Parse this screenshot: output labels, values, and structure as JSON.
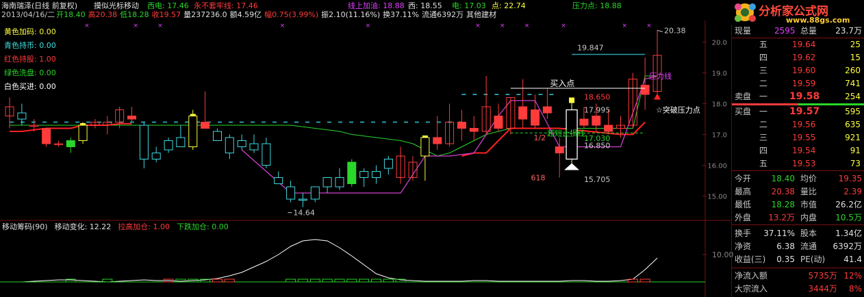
{
  "header": {
    "line1": [
      {
        "text": "海南瑞泽(日线 前复权)",
        "color": "#e0e0e0"
      },
      {
        "text": "摸似光标移动",
        "color": "#e0e0e0"
      },
      {
        "text": "西电: 17.46",
        "color": "#2ad62a"
      },
      {
        "text": "永不套牢线: 17.46",
        "color": "#ff3b3b"
      },
      {
        "text": "线上加油: 18.88",
        "color": "#e040fb"
      },
      {
        "text": "西: 18.55",
        "color": "#e0e0e0"
      },
      {
        "text": "电: 17.03",
        "color": "#2ad62a"
      },
      {
        "text": "点: 22.74",
        "color": "#ffff40"
      },
      {
        "text": "压力点: 18.88",
        "color": "#2ad62a"
      }
    ],
    "line2": [
      {
        "text": "2013/04/16/二",
        "color": "#c8c8c8"
      },
      {
        "text": "开18.40",
        "color": "#2ad62a"
      },
      {
        "text": "高20.38",
        "color": "#ff3b3b"
      },
      {
        "text": "低18.28",
        "color": "#2ad62a"
      },
      {
        "text": "收19.57",
        "color": "#ff3b3b"
      },
      {
        "text": "量237236.0",
        "color": "#e0e0e0"
      },
      {
        "text": "额4.59亿",
        "color": "#e0e0e0"
      },
      {
        "text": "幅0.75(3.99%)",
        "color": "#ff3b3b"
      },
      {
        "text": "振2.10(11.16%)",
        "color": "#e0e0e0"
      },
      {
        "text": "换37.11%",
        "color": "#e0e0e0"
      },
      {
        "text": "流通6392万",
        "color": "#e0e0e0"
      },
      {
        "text": "其他建材",
        "color": "#e0e0e0"
      }
    ]
  },
  "legend": [
    {
      "label": "黄色加码: 0.00",
      "color": "#ffff40"
    },
    {
      "label": "青色持币: 0.00",
      "color": "#40e0e0"
    },
    {
      "label": "红色持股: 1.00",
      "color": "#ff3b3b"
    },
    {
      "label": "绿色洗盘: 0.00",
      "color": "#2ad62a"
    },
    {
      "label": "白色买进: 0.00",
      "color": "#ffffff"
    }
  ],
  "indicator": {
    "items": [
      {
        "text": "移动筹码(90)",
        "color": "#e0e0e0"
      },
      {
        "text": "移动变化: 12.22",
        "color": "#e0e0e0"
      },
      {
        "text": "拉高加仓: 1.00",
        "color": "#ff3b3b"
      },
      {
        "text": "下跌加仓: 0.00",
        "color": "#2ad62a"
      }
    ],
    "axis_label": "10.00"
  },
  "brand": {
    "title": "分析家公式网",
    "url": "www.88gs.com"
  },
  "annotations": {
    "buy_point": "买入点",
    "pressure_line": "压力线",
    "breakout": "☆突破压力点",
    "cut_loss": "超短止损线",
    "half": "1/2",
    "low_mark": "618",
    "low_price": "14.64",
    "high_price": "20.38",
    "levels": [
      "19.847",
      "18.650",
      "17.995",
      "17.030",
      "16.850",
      "15.705"
    ]
  },
  "price_axis": [
    "20.0",
    "19.0",
    "18.0",
    "17.0",
    "16.00",
    "15.00"
  ],
  "quote": {
    "xianliang": {
      "label": "现量",
      "value": "2595"
    },
    "zongliang": {
      "label": "总量",
      "value": "23.7万"
    },
    "asks": [
      {
        "label": "五",
        "price": "19.64",
        "vol": "25"
      },
      {
        "label": "四",
        "price": "19.62",
        "vol": "15"
      },
      {
        "label": "三",
        "price": "19.60",
        "vol": "260"
      },
      {
        "label": "二",
        "price": "19.59",
        "vol": "741"
      },
      {
        "label": "一",
        "price": "19.58",
        "vol": "254"
      }
    ],
    "ask_title": "卖盘",
    "bid_title": "买盘",
    "bids": [
      {
        "label": "一",
        "price": "19.57",
        "vol": "595"
      },
      {
        "label": "二",
        "price": "19.56",
        "vol": "635"
      },
      {
        "label": "三",
        "price": "19.55",
        "vol": "921"
      },
      {
        "label": "四",
        "price": "19.54",
        "vol": "91"
      },
      {
        "label": "五",
        "price": "19.53",
        "vol": "73"
      }
    ],
    "stats": [
      {
        "l1": "今开",
        "v1": "18.40",
        "c1": "#2ad62a",
        "l2": "均价",
        "v2": "19.35",
        "c2": "#ff3b3b"
      },
      {
        "l1": "最高",
        "v1": "20.38",
        "c1": "#ff3b3b",
        "l2": "量比",
        "v2": "2.39",
        "c2": "#ff3b3b"
      },
      {
        "l1": "最低",
        "v1": "18.28",
        "c1": "#2ad62a",
        "l2": "市值",
        "v2": "26.2亿",
        "c2": "#e0e0e0"
      },
      {
        "l1": "外盘",
        "v1": "13.2万",
        "c1": "#ff3b3b",
        "l2": "内盘",
        "v2": "10.5万",
        "c2": "#2ad62a"
      }
    ],
    "stats2": [
      {
        "l1": "换手",
        "v1": "37.11%",
        "l2": "股本",
        "v2": "1.34亿"
      },
      {
        "l1": "净资",
        "v1": "6.38",
        "l2": "流通",
        "v2": "6392万"
      },
      {
        "l1": "收益(三)",
        "v1": "0.35",
        "l2": "PE(动)",
        "v2": "41.4"
      }
    ],
    "flows": [
      {
        "label": "净流入额",
        "value": "5735万",
        "pct": "12%"
      },
      {
        "label": "大宗流入",
        "value": "3444万",
        "pct": "8%"
      }
    ]
  },
  "chart_data": {
    "type": "candlestick",
    "y_axis_ticks": [
      20,
      19,
      18,
      17,
      16,
      15
    ],
    "ylim": [
      14.3,
      20.7
    ],
    "candles": [
      {
        "o": 17.6,
        "h": 18.2,
        "l": 17.2,
        "c": 17.9
      },
      {
        "o": 17.7,
        "h": 18.0,
        "l": 17.3,
        "c": 17.5
      },
      {
        "o": 17.3,
        "h": 17.5,
        "l": 17.1,
        "c": 17.3
      },
      {
        "o": 17.2,
        "h": 17.2,
        "l": 16.6,
        "c": 16.7
      },
      {
        "o": 16.7,
        "h": 16.8,
        "l": 16.6,
        "c": 16.7
      },
      {
        "o": 16.6,
        "h": 16.9,
        "l": 16.4,
        "c": 16.8
      },
      {
        "o": 16.8,
        "h": 17.4,
        "l": 16.7,
        "c": 17.3
      },
      {
        "o": 17.3,
        "h": 17.5,
        "l": 17.2,
        "c": 17.4
      },
      {
        "o": 17.3,
        "h": 17.6,
        "l": 17.0,
        "c": 17.4
      },
      {
        "o": 17.4,
        "h": 17.9,
        "l": 17.2,
        "c": 17.8
      },
      {
        "o": 17.6,
        "h": 17.9,
        "l": 17.4,
        "c": 17.5
      },
      {
        "o": 17.3,
        "h": 17.4,
        "l": 15.9,
        "c": 16.2
      },
      {
        "o": 16.4,
        "h": 16.6,
        "l": 16.1,
        "c": 16.2
      },
      {
        "o": 16.5,
        "h": 16.9,
        "l": 16.4,
        "c": 16.8
      },
      {
        "o": 16.9,
        "h": 17.3,
        "l": 16.6,
        "c": 16.6
      },
      {
        "o": 16.6,
        "h": 17.8,
        "l": 16.5,
        "c": 17.6
      },
      {
        "o": 17.4,
        "h": 18.4,
        "l": 17.3,
        "c": 17.2
      },
      {
        "o": 17.1,
        "h": 17.2,
        "l": 16.8,
        "c": 16.8
      },
      {
        "o": 16.9,
        "h": 17.0,
        "l": 16.2,
        "c": 16.4
      },
      {
        "o": 16.8,
        "h": 17.0,
        "l": 16.5,
        "c": 16.6
      },
      {
        "o": 16.7,
        "h": 17.0,
        "l": 16.4,
        "c": 16.5
      },
      {
        "o": 16.7,
        "h": 16.9,
        "l": 15.9,
        "c": 16.0
      },
      {
        "o": 15.6,
        "h": 15.8,
        "l": 15.4,
        "c": 15.4
      },
      {
        "o": 15.3,
        "h": 15.5,
        "l": 14.8,
        "c": 14.9
      },
      {
        "o": 14.9,
        "h": 15.1,
        "l": 14.64,
        "c": 14.9
      },
      {
        "o": 14.9,
        "h": 15.3,
        "l": 14.8,
        "c": 15.3
      },
      {
        "o": 15.3,
        "h": 15.6,
        "l": 15.1,
        "c": 15.6
      },
      {
        "o": 15.6,
        "h": 15.9,
        "l": 15.2,
        "c": 15.3
      },
      {
        "o": 15.4,
        "h": 16.2,
        "l": 15.3,
        "c": 16.1
      },
      {
        "o": 15.6,
        "h": 15.9,
        "l": 15.3,
        "c": 15.8
      },
      {
        "o": 15.8,
        "h": 16.0,
        "l": 15.4,
        "c": 15.6
      },
      {
        "o": 15.9,
        "h": 16.3,
        "l": 15.7,
        "c": 16.2
      },
      {
        "o": 15.6,
        "h": 16.6,
        "l": 15.4,
        "c": 16.3
      },
      {
        "o": 15.6,
        "h": 16.3,
        "l": 15.5,
        "c": 16.1
      },
      {
        "o": 16.3,
        "h": 16.9,
        "l": 15.5,
        "c": 16.9
      },
      {
        "o": 16.9,
        "h": 17.6,
        "l": 16.5,
        "c": 16.7
      },
      {
        "o": 16.7,
        "h": 18.0,
        "l": 16.6,
        "c": 17.4
      },
      {
        "o": 17.4,
        "h": 17.8,
        "l": 16.8,
        "c": 17.2
      },
      {
        "o": 17.2,
        "h": 17.6,
        "l": 16.8,
        "c": 17.1
      },
      {
        "o": 17.1,
        "h": 18.9,
        "l": 17.0,
        "c": 17.9
      },
      {
        "o": 17.6,
        "h": 18.0,
        "l": 17.1,
        "c": 17.2
      },
      {
        "o": 17.2,
        "h": 18.2,
        "l": 17.0,
        "c": 18.2
      },
      {
        "o": 17.9,
        "h": 18.8,
        "l": 17.2,
        "c": 17.5
      },
      {
        "o": 17.8,
        "h": 18.3,
        "l": 17.2,
        "c": 17.3
      },
      {
        "o": 17.9,
        "h": 18.5,
        "l": 17.5,
        "c": 17.7
      },
      {
        "o": 16.6,
        "h": 16.9,
        "l": 15.6,
        "c": 16.4
      },
      {
        "o": 16.2,
        "h": 18.2,
        "l": 16.0,
        "c": 17.6
      },
      {
        "o": 17.5,
        "h": 17.9,
        "l": 17.2,
        "c": 17.3
      },
      {
        "o": 17.6,
        "h": 18.0,
        "l": 17.1,
        "c": 17.3
      },
      {
        "o": 17.3,
        "h": 17.8,
        "l": 17.0,
        "c": 17.1
      },
      {
        "o": 17.2,
        "h": 17.6,
        "l": 16.9,
        "c": 17.3
      },
      {
        "o": 17.3,
        "h": 19.0,
        "l": 17.2,
        "c": 18.8
      },
      {
        "o": 18.6,
        "h": 19.5,
        "l": 17.8,
        "c": 18.3
      },
      {
        "o": 18.4,
        "h": 20.38,
        "l": 18.28,
        "c": 19.57
      }
    ],
    "upper_colors": [
      "red",
      "cyan",
      "red",
      "red",
      "red",
      "green",
      "yellow",
      "red",
      "red",
      "red",
      "red",
      "cyan",
      "cyan",
      "cyan",
      "cyan",
      "yellow",
      "red",
      "cyan",
      "cyan",
      "cyan",
      "cyan",
      "cyan",
      "cyan",
      "cyan",
      "cyan",
      "cyan",
      "cyan",
      "cyan",
      "green",
      "cyan",
      "cyan",
      "cyan",
      "red",
      "red",
      "yellow",
      "red",
      "red",
      "red",
      "red",
      "red",
      "red",
      "red",
      "red",
      "red",
      "red",
      "red",
      "yellow",
      "red",
      "red",
      "red",
      "red",
      "red",
      "red",
      "red"
    ]
  }
}
